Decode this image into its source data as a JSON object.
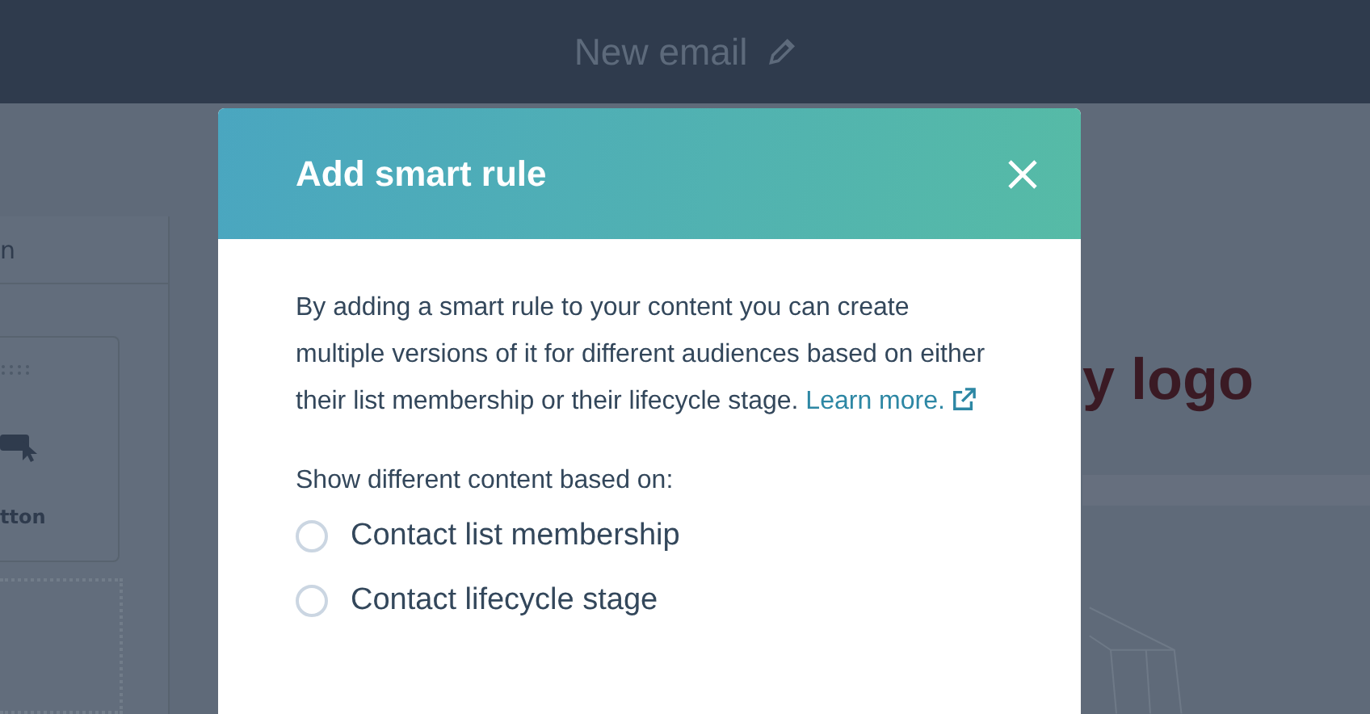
{
  "header": {
    "title": "New email"
  },
  "sidebar": {
    "tab_label": "n",
    "card_label": "tton"
  },
  "canvas": {
    "logo_text": "y logo"
  },
  "modal": {
    "title": "Add smart rule",
    "description": "By adding a smart rule to your content you can create multiple versions of it for different audiences based on either their list membership or their lifecycle stage.",
    "link": "Learn more.",
    "question": "Show different content based on:",
    "options": [
      {
        "label": "Contact list membership",
        "selected": false
      },
      {
        "label": "Contact lifecycle stage",
        "selected": false
      }
    ]
  }
}
